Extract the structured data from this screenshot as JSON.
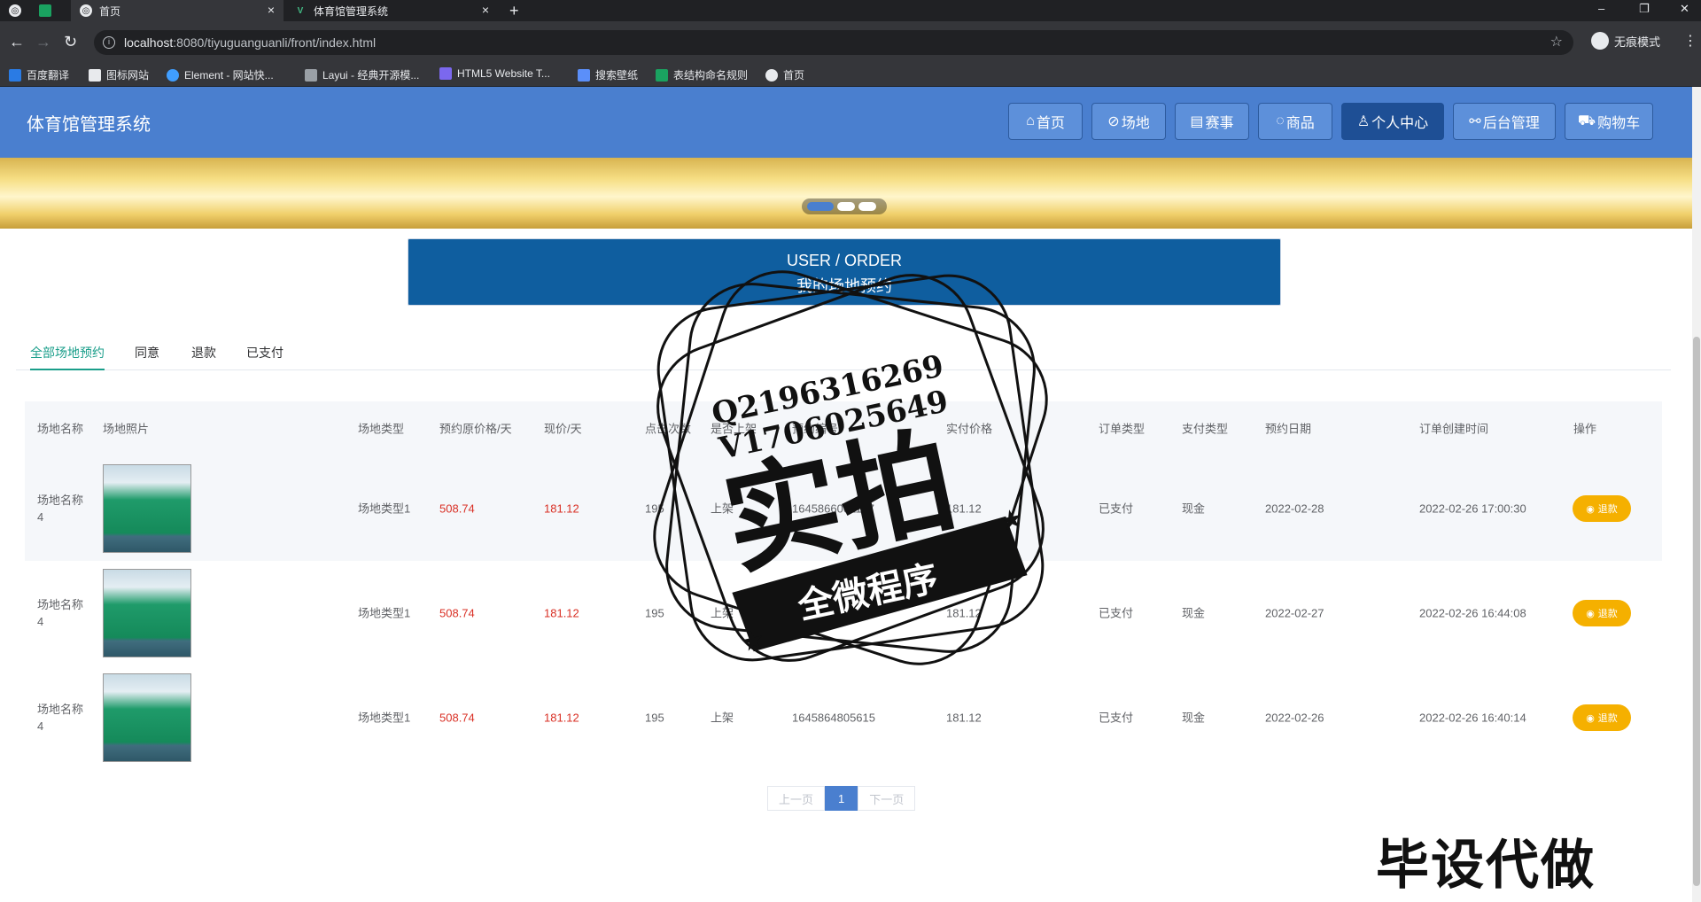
{
  "browser": {
    "tabs": [
      {
        "title": ""
      },
      {
        "title": ""
      },
      {
        "title": "首页"
      },
      {
        "title": "体育馆管理系统"
      }
    ],
    "url_host": "localhost",
    "url_path": ":8080/tiyuguanguanli/front/index.html",
    "incognito_label": "无痕模式",
    "bookmarks": [
      "百度翻译",
      "图标网站",
      "Element - 网站快...",
      "Layui - 经典开源模...",
      "HTML5 Website T...",
      "搜索壁纸",
      "表结构命名规则",
      "首页"
    ]
  },
  "site": {
    "title": "体育馆管理系统",
    "nav": [
      {
        "label": "首页",
        "icon": "home-icon"
      },
      {
        "label": "场地",
        "icon": "venue-icon"
      },
      {
        "label": "赛事",
        "icon": "event-icon"
      },
      {
        "label": "商品",
        "icon": "goods-icon"
      },
      {
        "label": "个人中心",
        "icon": "user-icon"
      },
      {
        "label": "后台管理",
        "icon": "link-icon"
      },
      {
        "label": "购物车",
        "icon": "cart-icon"
      }
    ],
    "active_nav": "个人中心"
  },
  "section": {
    "en": "USER / ORDER",
    "zh": "我的场地预约"
  },
  "order_tabs": [
    "全部场地预约",
    "同意",
    "退款",
    "已支付"
  ],
  "table": {
    "columns": [
      "场地名称",
      "场地照片",
      "场地类型",
      "预约原价格/天",
      "现价/天",
      "点击次数",
      "是否上架",
      "预约编号",
      "实付价格",
      "订单类型",
      "支付类型",
      "预约日期",
      "订单创建时间",
      "操作"
    ],
    "rows": [
      {
        "name": "场地名称4",
        "type": "场地类型1",
        "orig_price": "508.74",
        "price": "181.12",
        "clicks": "195",
        "status": "上架",
        "order_no": "1645866001197",
        "paid": "181.12",
        "order_type": "已支付",
        "pay_type": "现金",
        "date": "2022-02-28",
        "created": "2022-02-26 17:00:30",
        "action": "退款"
      },
      {
        "name": "场地名称4",
        "type": "场地类型1",
        "orig_price": "508.74",
        "price": "181.12",
        "clicks": "195",
        "status": "上架",
        "order_no": "1645865039636",
        "paid": "181.12",
        "order_type": "已支付",
        "pay_type": "现金",
        "date": "2022-02-27",
        "created": "2022-02-26 16:44:08",
        "action": "退款"
      },
      {
        "name": "场地名称4",
        "type": "场地类型1",
        "orig_price": "508.74",
        "price": "181.12",
        "clicks": "195",
        "status": "上架",
        "order_no": "1645864805615",
        "paid": "181.12",
        "order_type": "已支付",
        "pay_type": "现金",
        "date": "2022-02-26",
        "created": "2022-02-26 16:40:14",
        "action": "退款"
      }
    ]
  },
  "pager": {
    "prev": "上一页",
    "current": "1",
    "next": "下一页"
  },
  "watermark": {
    "line1": "Q2196316269",
    "line2": "V1706025649",
    "big": "实拍",
    "ribbon": "全微程序",
    "corner": "毕设代做"
  }
}
